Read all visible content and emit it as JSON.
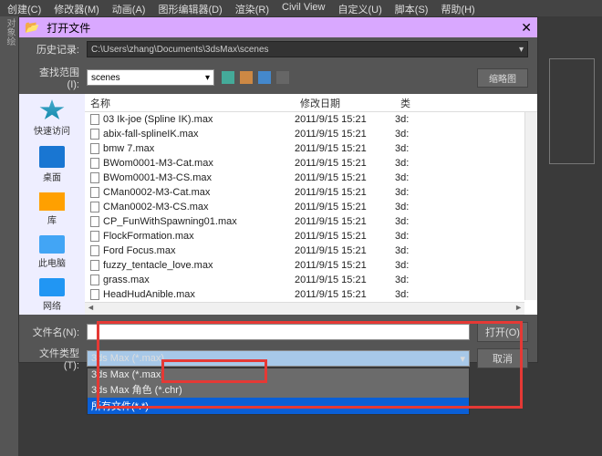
{
  "menu": [
    "创建(C)",
    "修改器(M)",
    "动画(A)",
    "图形编辑器(D)",
    "渲染(R)",
    "Civil View",
    "自定义(U)",
    "脚本(S)",
    "帮助(H)"
  ],
  "left_label": "对象绘",
  "dialog": {
    "title": "打开文件",
    "history_label": "历史记录:",
    "history_value": "C:\\Users\\zhang\\Documents\\3dsMax\\scenes",
    "folder_label": "查找范围(I):",
    "folder_value": "scenes",
    "thumb_btn": "缩略图",
    "filename_label": "文件名(N):",
    "filetype_label": "文件类型(T):",
    "filetype_value": "3ds Max (*.max)",
    "open_btn": "打开(O)",
    "cancel_btn": "取消",
    "filetype_options": [
      "3ds Max (*.max)",
      "3ds Max 角色 (*.chr)",
      "所有文件(*.*)"
    ]
  },
  "sidebar": [
    {
      "label": "快速访问",
      "ic": "ic-quick"
    },
    {
      "label": "桌面",
      "ic": "ic-desktop"
    },
    {
      "label": "库",
      "ic": "ic-lib"
    },
    {
      "label": "此电脑",
      "ic": "ic-pc"
    },
    {
      "label": "网络",
      "ic": "ic-net"
    }
  ],
  "columns": {
    "name": "名称",
    "date": "修改日期",
    "type": "类"
  },
  "files": [
    {
      "n": "03 Ik-joe (Spline IK).max",
      "d": "2011/9/15 15:21",
      "t": "3d:"
    },
    {
      "n": "abix-fall-splineIK.max",
      "d": "2011/9/15 15:21",
      "t": "3d:"
    },
    {
      "n": "bmw 7.max",
      "d": "2011/9/15 15:21",
      "t": "3d:"
    },
    {
      "n": "BWom0001-M3-Cat.max",
      "d": "2011/9/15 15:21",
      "t": "3d:"
    },
    {
      "n": "BWom0001-M3-CS.max",
      "d": "2011/9/15 15:21",
      "t": "3d:"
    },
    {
      "n": "CMan0002-M3-Cat.max",
      "d": "2011/9/15 15:21",
      "t": "3d:"
    },
    {
      "n": "CMan0002-M3-CS.max",
      "d": "2011/9/15 15:21",
      "t": "3d:"
    },
    {
      "n": "CP_FunWithSpawning01.max",
      "d": "2011/9/15 15:21",
      "t": "3d:"
    },
    {
      "n": "FlockFormation.max",
      "d": "2011/9/15 15:21",
      "t": "3d:"
    },
    {
      "n": "Ford Focus.max",
      "d": "2011/9/15 15:21",
      "t": "3d:"
    },
    {
      "n": "fuzzy_tentacle_love.max",
      "d": "2011/9/15 15:21",
      "t": "3d:"
    },
    {
      "n": "grass.max",
      "d": "2011/9/15 15:21",
      "t": "3d:"
    },
    {
      "n": "HeadHudAnible.max",
      "d": "2011/9/15 15:21",
      "t": "3d:"
    }
  ]
}
